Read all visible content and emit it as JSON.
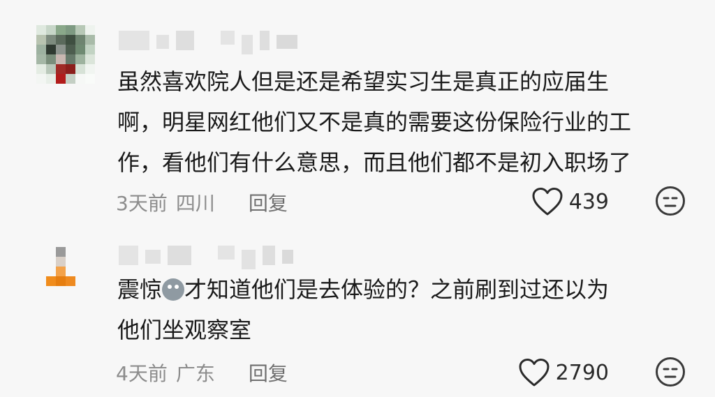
{
  "comments": [
    {
      "text": "虽然喜欢院人但是还是希望实习生是真正的应届生\n啊，明星网红他们又不是真的需要这份保险行业的工\n作，看他们有什么意思，而且他们都不是初入职场了",
      "time": "3天前",
      "location": "四川",
      "reply_label": "回复",
      "likes": "439",
      "avatar_colors": [
        "#dfe9df",
        "#c7d6c8",
        "#8aa88a",
        "#7e9a82",
        "#b7c8b6",
        "#eef3ee",
        "#b8c3b0",
        "#7d8b7e",
        "#5b6a5c",
        "#3f4f41",
        "#6e8470",
        "#a9bba9",
        "#9db1a0",
        "#2f3a31",
        "#8d948e",
        "#4d5d4f",
        "#6f8a72",
        "#c2d3c3",
        "#a5b7a6",
        "#7a8e7b",
        "#c9b7b1",
        "#66796a",
        "#9eb39f",
        "#dbe5da",
        "#e4ece3",
        "#b9c8ba",
        "#a02a26",
        "#8c1f1c",
        "#d7e2d7",
        "#f1f5f1",
        "#f3f6f3",
        "#e8efe8",
        "#b21c1b",
        "#c4cfc4",
        "#f6f8f6",
        "#f9fbf9"
      ],
      "username_blocks": [
        44,
        18,
        26,
        0,
        20,
        16,
        14,
        30
      ]
    },
    {
      "text_before_emoji": "震惊",
      "emoji_name": "shocked-face-emoji",
      "text_after_emoji": "才知道他们是去体验的？之前刷到过还以为\n他们坐观察室",
      "time": "4天前",
      "location": "广东",
      "reply_label": "回复",
      "likes": "2790",
      "avatar_colors": [
        "#f7f7f7",
        "#9a9a9a",
        "#f7f7f7",
        "#f7f7f7",
        "#f7f7f7",
        "#d9d0c8",
        "#f7f7f7",
        "#f7f7f7",
        "#f7f7f7",
        "#f3a24a",
        "#f7f7f7",
        "#f7f7f7",
        "#f08c1c",
        "#e67e10",
        "#ee8a20",
        "#f7f7f7",
        "#f7f7f7",
        "#f7f7f7",
        "#f7f7f7",
        "#f7f7f7",
        "#f7f7f7",
        "#f7f7f7",
        "#f7f7f7",
        "#f7f7f7"
      ],
      "username_blocks": [
        28,
        22,
        34,
        0,
        24,
        20,
        18,
        16
      ]
    }
  ],
  "colors": {
    "background": "#f7f7f7",
    "text": "#1a1a1a",
    "meta_text": "#8c8c8c"
  }
}
